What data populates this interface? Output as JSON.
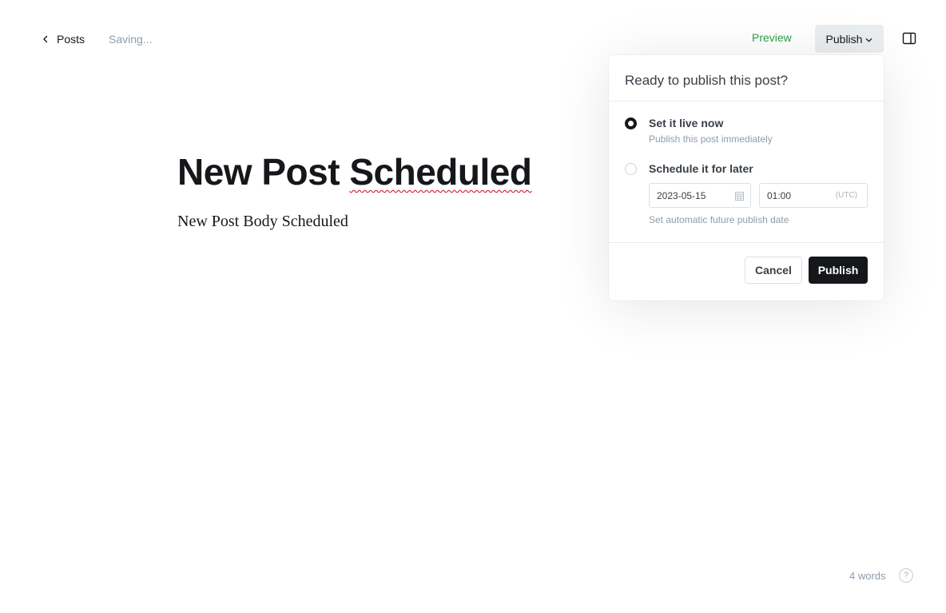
{
  "header": {
    "back_label": "Posts",
    "status": "Saving...",
    "preview_label": "Preview",
    "publish_menu_label": "Publish"
  },
  "editor": {
    "title_word1": "New Post",
    "title_word2": "Scheduled",
    "body": "New Post Body Scheduled"
  },
  "publish_popover": {
    "heading": "Ready to publish this post?",
    "options": [
      {
        "label": "Set it live now",
        "description": "Publish this post immediately",
        "selected": true
      },
      {
        "label": "Schedule it for later",
        "description": "Set automatic future publish date",
        "selected": false
      }
    ],
    "date_value": "2023-05-15",
    "time_value": "01:00",
    "timezone": "(UTC)",
    "cancel_label": "Cancel",
    "publish_label": "Publish"
  },
  "footer": {
    "word_count": "4 words",
    "help_glyph": "?"
  },
  "colors": {
    "preview_green": "#30a046",
    "primary_dark": "#15171a",
    "muted_text": "#8e9cac"
  },
  "icons": [
    "chevron-left-icon",
    "chevron-down-icon",
    "sidebar-panel-icon",
    "calendar-icon",
    "help-icon"
  ]
}
